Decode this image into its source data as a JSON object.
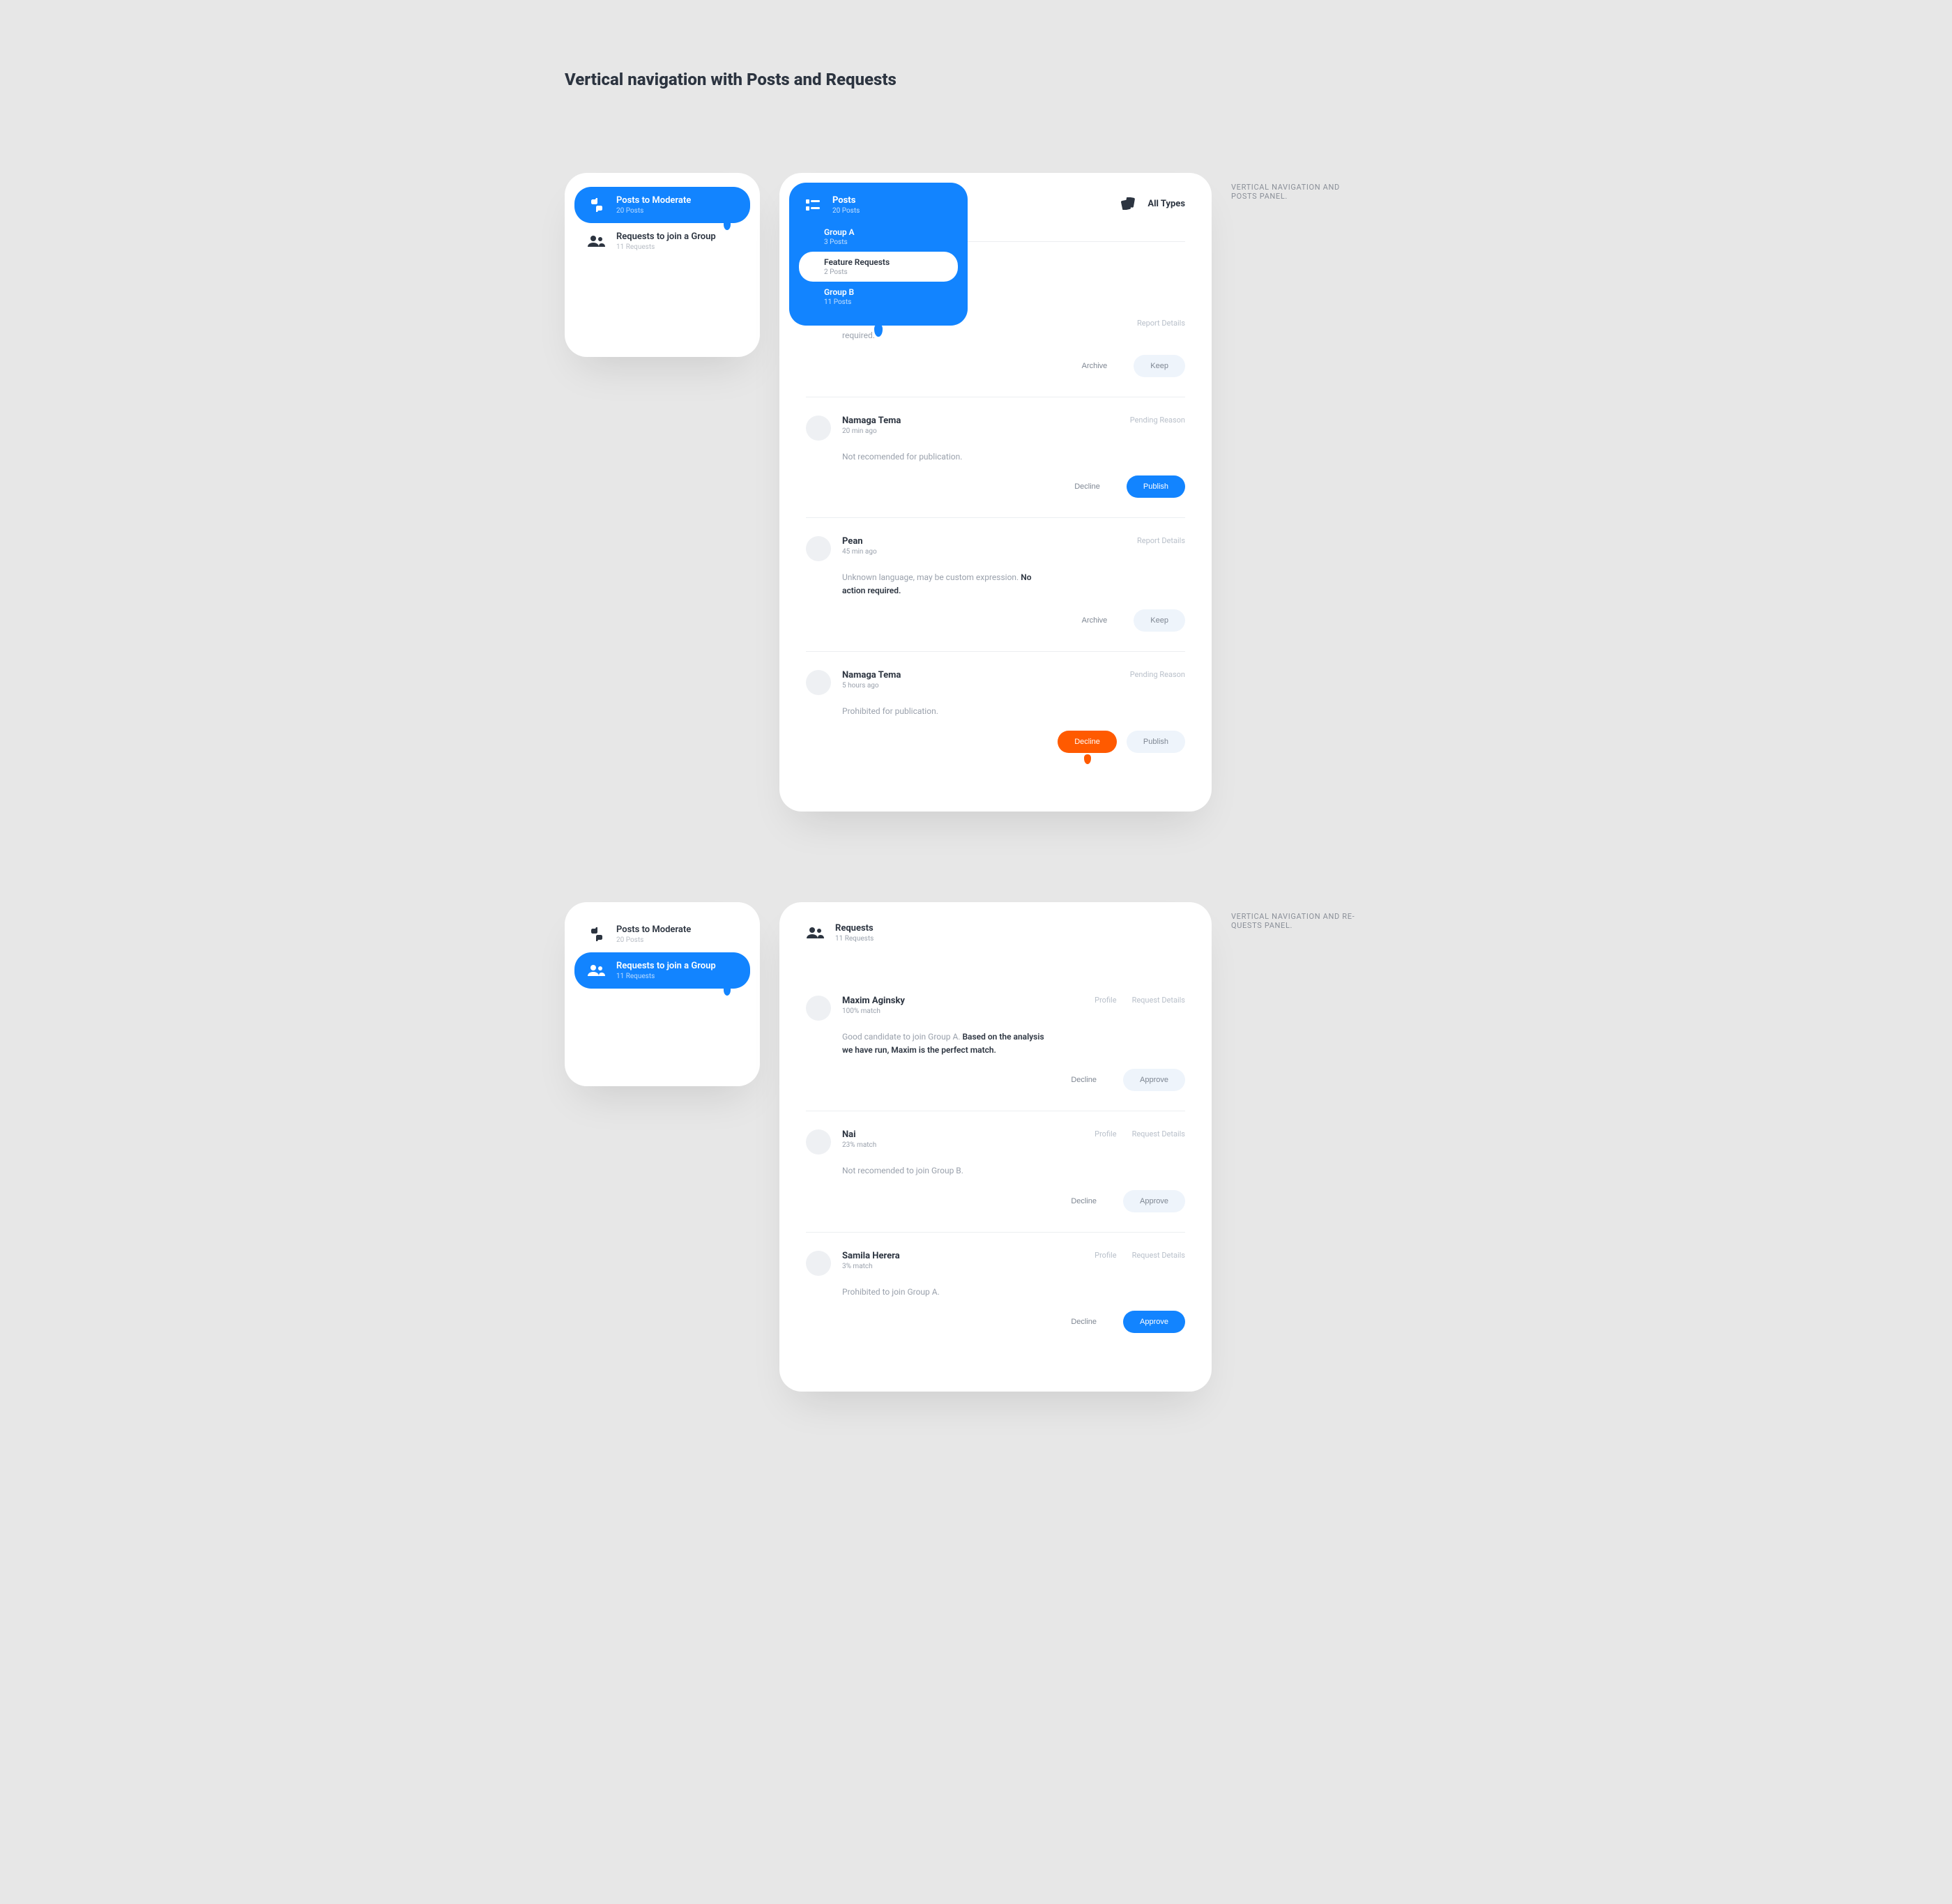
{
  "page_title": "Vertical navigation with Posts and Requests",
  "captions": {
    "posts": "VERTICAL NAVIGATION AND POSTS PANEL.",
    "requests": "VERTICAL NAVIGATION AND RE-QUESTS PANEL."
  },
  "nav": {
    "posts": {
      "label": "Posts to Moderate",
      "sub": "20 Posts"
    },
    "requests": {
      "label": "Requests to join a Group",
      "sub": "11 Requests"
    }
  },
  "posts_panel": {
    "head_posts": {
      "label": "Posts",
      "sub": "20 Posts"
    },
    "head_types": {
      "label": "All Types"
    },
    "dropdown": {
      "head": {
        "label": "Posts",
        "sub": "20 Posts"
      },
      "items": [
        {
          "label": "Group A",
          "sub": "3 Posts"
        },
        {
          "label": "Feature Requests",
          "sub": "2 Posts"
        },
        {
          "label": "Group B",
          "sub": "11 Posts"
        }
      ]
    },
    "posts": [
      {
        "name": "",
        "time": "",
        "desc_tail": "required.",
        "link": "Report Details",
        "a1": "Archive",
        "a2": "Keep",
        "style": "pill"
      },
      {
        "name": "Namaga Tema",
        "time": "20 min ago",
        "desc": "Not recomended for publication.",
        "link": "Pending Reason",
        "a1": "Decline",
        "a2": "Publish",
        "style": "blue"
      },
      {
        "name": "Pean",
        "time": "45 min ago",
        "desc": "Unknown language, may be custom expression.",
        "desc_strong": "No action required.",
        "link": "Report Details",
        "a1": "Archive",
        "a2": "Keep",
        "style": "pill"
      },
      {
        "name": "Namaga Tema",
        "time": "5 hours ago",
        "desc": "Prohibited for publication.",
        "link": "Pending Reason",
        "a1": "Decline",
        "a2": "Publish",
        "style": "pill",
        "primary": "orange"
      }
    ]
  },
  "requests_panel": {
    "head": {
      "label": "Requests",
      "sub": "11 Requests"
    },
    "link_profile": "Profile",
    "link_details": "Request Details",
    "items": [
      {
        "name": "Maxim Aginsky",
        "match": "100% match",
        "desc": "Good candidate to join Group A.",
        "desc_strong": "Based on the analysis we have run, Maxim is the perfect match.",
        "a1": "Decline",
        "a2": "Approve",
        "style": "pill"
      },
      {
        "name": "Nai",
        "match": "23% match",
        "desc": "Not recomended to join Group B.",
        "a1": "Decline",
        "a2": "Approve",
        "style": "pill"
      },
      {
        "name": "Samila Herera",
        "match": "3% match",
        "desc": "Prohibited to join Group A.",
        "a1": "Decline",
        "a2": "Approve",
        "style": "blue"
      }
    ]
  }
}
